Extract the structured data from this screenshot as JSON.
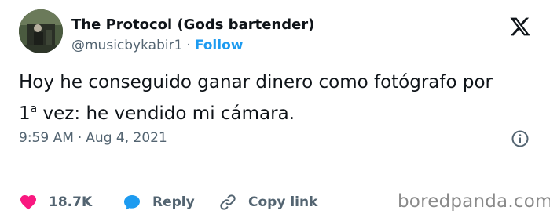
{
  "author": {
    "name": "The Protocol (Gods bartender)",
    "handle": "@musicbykabir1",
    "separator": "·",
    "follow_label": "Follow"
  },
  "tweet": {
    "line1": "Hoy he conseguido ganar dinero como fotógrafo por",
    "line2_prefix": "1",
    "line2_sup": "a",
    "line2_rest": " vez: he vendido mi cámara."
  },
  "meta": {
    "time": "9:59 AM",
    "separator": "·",
    "date": "Aug 4, 2021"
  },
  "actions": {
    "like_count": "18.7K",
    "reply_label": "Reply",
    "copy_label": "Copy link"
  },
  "watermark": "boredpanda.com",
  "icons": {
    "brand": "x-logo-icon",
    "info": "info-icon",
    "like": "heart-icon",
    "reply": "speech-bubble-icon",
    "copy": "link-icon"
  },
  "colors": {
    "text": "#0f1419",
    "secondary": "#536471",
    "accent": "#1d9bf0",
    "like": "#f91880",
    "divider": "#eff3f4"
  }
}
